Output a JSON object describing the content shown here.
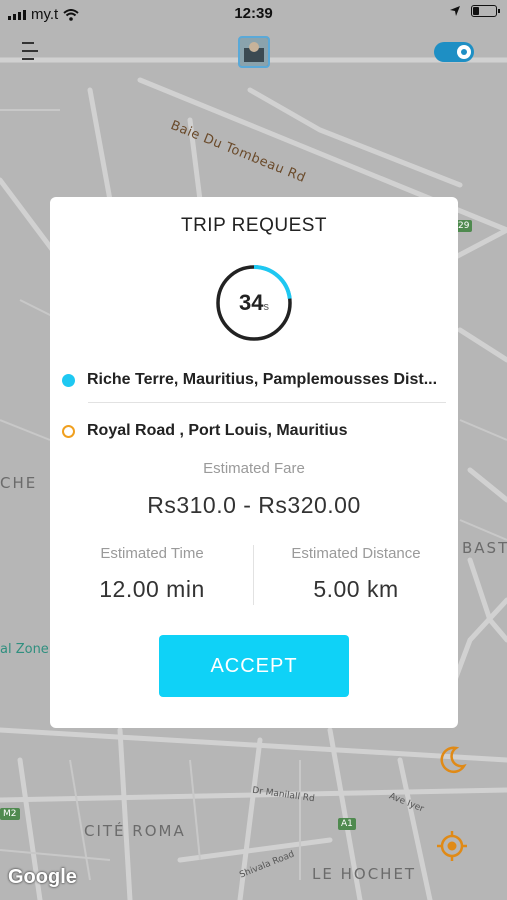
{
  "status_bar": {
    "carrier": "my.t",
    "time": "12:39"
  },
  "map": {
    "labels": {
      "road_baie": "Baie Du Tombeau Rd",
      "che": "CHE",
      "bast": "BAST",
      "zone": "al Zone",
      "cite_roma": "CITÉ ROMA",
      "le_hochet": "LE HOCHET",
      "dr_manilall": "Dr Manilall Rd",
      "shivala": "Shivala Road",
      "ave_iyer": "Ave Iyer",
      "a1": "A1",
      "m2": "M2",
      "r29": "29"
    },
    "attribution": "Google"
  },
  "header": {
    "online_toggle_on": true
  },
  "trip_request": {
    "title": "TRIP REQUEST",
    "timer": {
      "seconds": "34",
      "unit": "s",
      "progress_fraction": 0.23
    },
    "pickup": "Riche Terre, Mauritius, Pamplemousses Dist...",
    "dropoff": "Royal Road , Port Louis, Mauritius",
    "fare_label": "Estimated Fare",
    "fare_value": "Rs310.0 - Rs320.00",
    "time_label": "Estimated Time",
    "time_value": "12.00 min",
    "distance_label": "Estimated Distance",
    "distance_value": "5.00 km",
    "accept_label": "ACCEPT"
  },
  "colors": {
    "accent": "#0fd2f7",
    "pickup_dot": "#1ec8f2",
    "dropoff_dot": "#f0a020",
    "fab_orange": "#e08a16",
    "toggle": "#1e8fc4"
  }
}
